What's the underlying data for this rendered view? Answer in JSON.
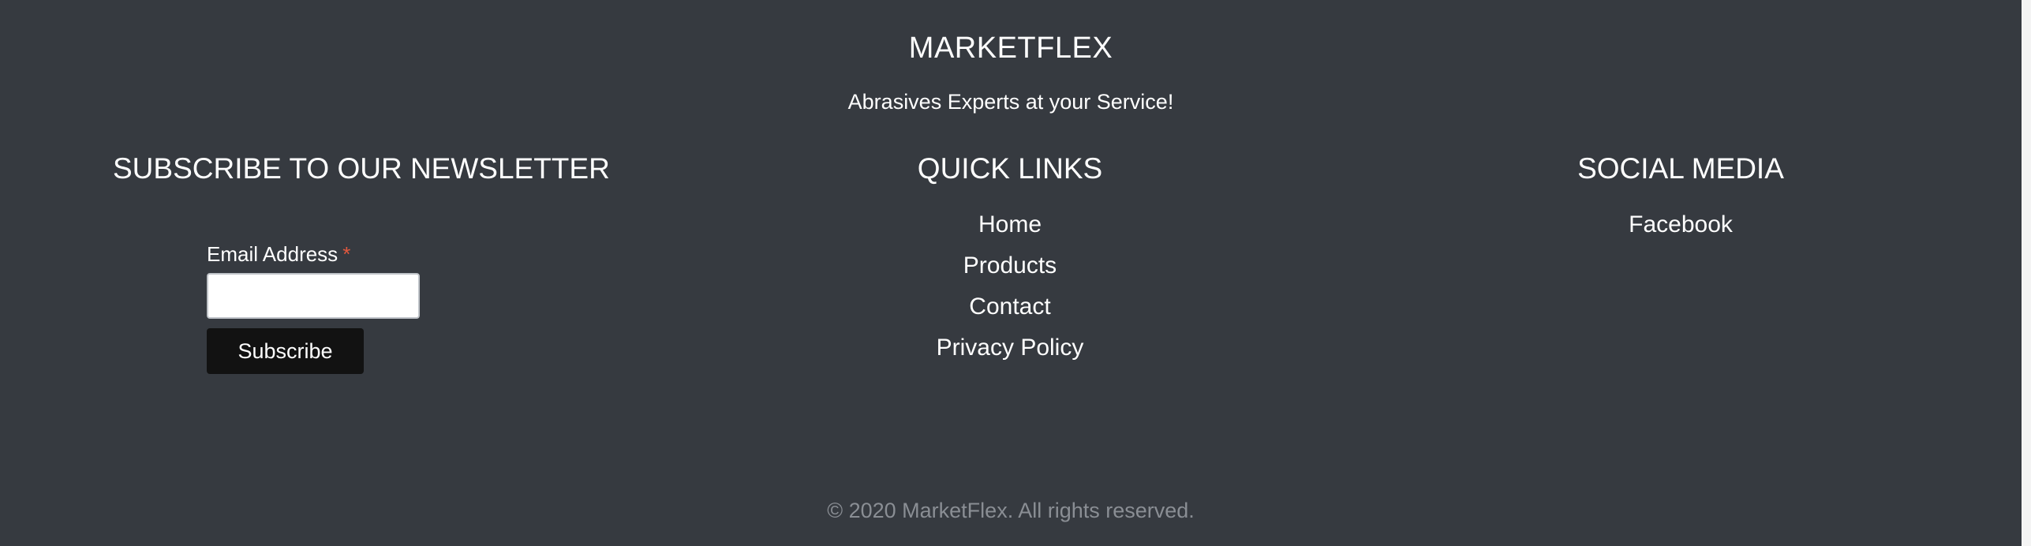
{
  "brand": {
    "title": "MARKETFLEX",
    "tagline": "Abrasives Experts at your Service!"
  },
  "newsletter": {
    "heading": "SUBSCRIBE TO OUR NEWSLETTER",
    "email_label": "Email Address",
    "required_marker": "*",
    "email_value": "",
    "subscribe_label": "Subscribe"
  },
  "quick_links": {
    "heading": "QUICK LINKS",
    "items": [
      {
        "label": "Home"
      },
      {
        "label": "Products"
      },
      {
        "label": "Contact"
      },
      {
        "label": "Privacy Policy"
      }
    ]
  },
  "social": {
    "heading": "SOCIAL MEDIA",
    "items": [
      {
        "label": "Facebook"
      }
    ]
  },
  "copyright": "© 2020 MarketFlex. All rights reserved.",
  "colors": {
    "background": "#363a40",
    "text": "#ffffff",
    "muted_text": "#8a8e94",
    "button": "#121212",
    "required": "#e2583e"
  }
}
